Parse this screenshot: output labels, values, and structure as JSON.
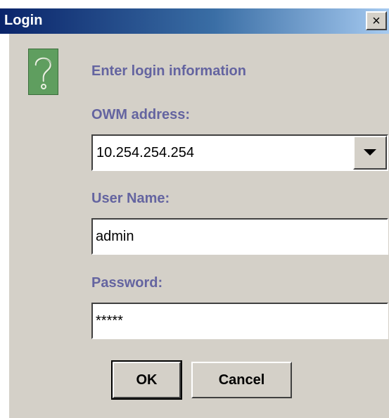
{
  "window": {
    "title": "Login",
    "close_icon": "×"
  },
  "dialog": {
    "icon": "question-icon",
    "heading": "Enter login information",
    "owm_address": {
      "label": "OWM address:",
      "value": "10.254.254.254"
    },
    "user_name": {
      "label": "User Name:",
      "value": "admin"
    },
    "password": {
      "label": "Password:",
      "value": "*****"
    },
    "ok_label": "OK",
    "cancel_label": "Cancel"
  },
  "colors": {
    "title_bar_start": "#0a246a",
    "title_bar_end": "#a6caf0",
    "dialog_bg": "#d4d0c8",
    "label_color": "#6464a0",
    "icon_green": "#5f9e5f"
  }
}
